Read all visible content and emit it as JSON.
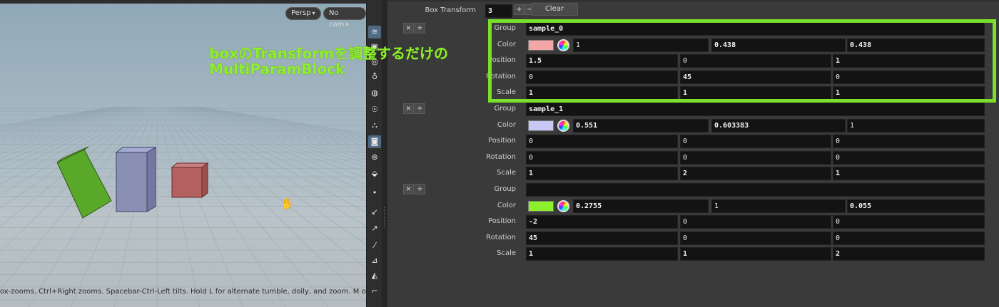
{
  "viewport": {
    "persp_label": "Persp",
    "cam_label": "No cam",
    "status_text": "ox-zooms. Ctrl+Right zooms. Spacebar-Ctrl-Left tilts. Hold L for alternate tumble, dolly, and zoom. M or Alt+M for",
    "overlay_line1": "boxのTransformを調整するだけの",
    "overlay_line2": "MultiParamBlock",
    "box_colors": [
      "#5aa82a",
      "#8a90b4",
      "#b46060"
    ]
  },
  "toolbar": {
    "icons": [
      "select-icon",
      "view-icon",
      "handle-icon",
      "light-icon",
      "sphere-icon",
      "bulb-icon",
      "geo-icon",
      "camera-icon",
      "eye-icon",
      "render-icon",
      "dot-icon",
      "snap-icon",
      "pin-icon",
      "grid-icon",
      "measure-icon",
      "shelf-icon",
      "corner-icon"
    ]
  },
  "params": {
    "box_transform_label": "Box Transform",
    "box_transform_value": "3",
    "plus_label": "+",
    "minus_label": "−",
    "clear_label": "Clear",
    "remove_label": "×",
    "insert_label": "+",
    "labels": {
      "group": "Group",
      "color": "Color",
      "position": "Position",
      "rotation": "Rotation",
      "scale": "Scale"
    },
    "blocks": [
      {
        "group": "sample_0",
        "swatch": "#f4a6a6",
        "color": [
          "1",
          "0.438",
          "0.438"
        ],
        "position": [
          "1.5",
          "0",
          "1"
        ],
        "rotation": [
          "0",
          "45",
          "0"
        ],
        "scale": [
          "1",
          "1",
          "1"
        ]
      },
      {
        "group": "sample_1",
        "swatch": "#c8c8f4",
        "color": [
          "0.551",
          "0.603383",
          "1"
        ],
        "position": [
          "0",
          "0",
          "0"
        ],
        "rotation": [
          "0",
          "0",
          "0"
        ],
        "scale": [
          "1",
          "2",
          "1"
        ]
      },
      {
        "group": "",
        "swatch": "#8cf02a",
        "color": [
          "0.2755",
          "1",
          "0.055"
        ],
        "position": [
          "-2",
          "0",
          "0"
        ],
        "rotation": [
          "45",
          "0",
          "0"
        ],
        "scale": [
          "1",
          "1",
          "2"
        ]
      }
    ]
  }
}
